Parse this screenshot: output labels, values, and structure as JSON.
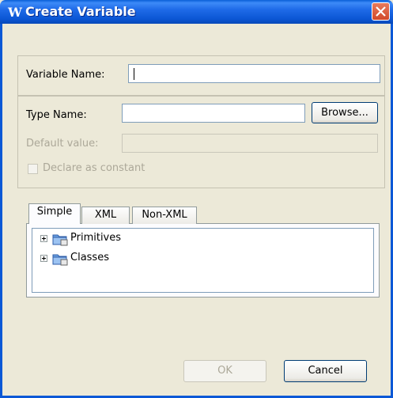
{
  "window": {
    "title": "Create Variable",
    "app_icon_glyph": "W",
    "close_icon": "close-icon"
  },
  "form": {
    "variable_name_label": "Variable Name:",
    "variable_name_value": "",
    "type_name_label": "Type Name:",
    "type_name_value": "",
    "browse_label": "Browse...",
    "default_value_label": "Default value:",
    "default_value_value": "",
    "declare_constant_label": "Declare as constant",
    "declare_constant_checked": false
  },
  "tabs": [
    {
      "label": "Simple",
      "active": true
    },
    {
      "label": "XML",
      "active": false
    },
    {
      "label": "Non-XML",
      "active": false
    }
  ],
  "tree": {
    "items": [
      {
        "label": "Primitives",
        "icon": "folder-package-icon",
        "expanded": false
      },
      {
        "label": "Classes",
        "icon": "folder-package-icon",
        "expanded": false
      }
    ]
  },
  "buttons": {
    "ok_label": "OK",
    "ok_enabled": false,
    "cancel_label": "Cancel"
  },
  "colors": {
    "titlebar": "#0b56d4",
    "dialog_bg": "#ece9d8",
    "close_button": "#d1492a"
  }
}
